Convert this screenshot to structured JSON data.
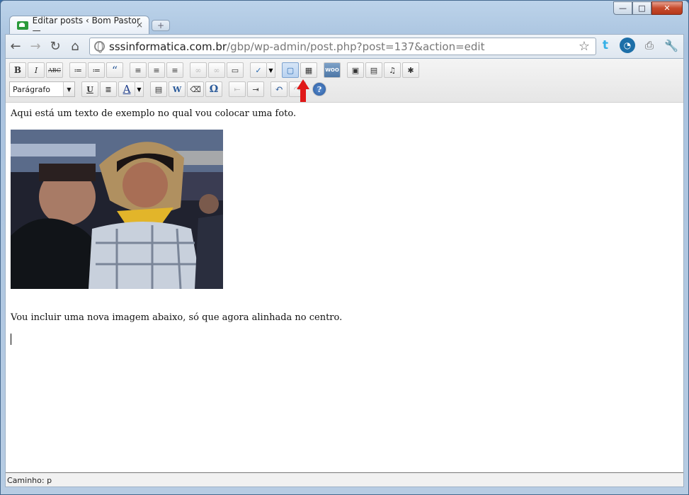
{
  "window": {
    "tab_title": "Editar posts ‹ Bom Pastor —",
    "tab_close": "×",
    "new_tab": "+",
    "controls": {
      "minimize": "—",
      "maximize": "□",
      "close": "✕"
    }
  },
  "navbar": {
    "back_icon": "←",
    "forward_icon": "→",
    "reload_icon": "↻",
    "home_icon": "⌂",
    "url_host": "sssinformatica.com.br",
    "url_path": "/gbp/wp-admin/post.php?post=137&action=edit",
    "bookmark_icon": "☆",
    "extensions": [
      {
        "name": "twitter-icon",
        "glyph": "t"
      },
      {
        "name": "clock-icon",
        "glyph": "◔"
      },
      {
        "name": "print-icon",
        "glyph": "⎙"
      },
      {
        "name": "wrench-icon",
        "glyph": "🔧"
      }
    ]
  },
  "toolbar": {
    "row1": [
      {
        "name": "bold",
        "glyph": "B"
      },
      {
        "name": "italic",
        "glyph": "I"
      },
      {
        "name": "strikethrough",
        "glyph": "ABC"
      },
      {
        "name": "bullet-list",
        "glyph": "≔"
      },
      {
        "name": "numbered-list",
        "glyph": "≔"
      },
      {
        "name": "blockquote",
        "glyph": "“"
      },
      {
        "name": "align-left",
        "glyph": "≡"
      },
      {
        "name": "align-center",
        "glyph": "≡"
      },
      {
        "name": "align-right",
        "glyph": "≡"
      },
      {
        "name": "link",
        "glyph": "∞"
      },
      {
        "name": "unlink",
        "glyph": "∞"
      },
      {
        "name": "more-tag",
        "glyph": "▭"
      },
      {
        "name": "spellcheck",
        "glyph": "✓"
      },
      {
        "name": "fullscreen",
        "glyph": "▢"
      },
      {
        "name": "kitchen-sink",
        "glyph": "▦"
      },
      {
        "name": "woo-shortcodes",
        "glyph": "WOO"
      },
      {
        "name": "add-image",
        "glyph": "▣"
      },
      {
        "name": "add-gallery",
        "glyph": "▤"
      },
      {
        "name": "add-audio",
        "glyph": "♫"
      },
      {
        "name": "add-media",
        "glyph": "✱"
      }
    ],
    "row2": {
      "format_select": "Parágrafo",
      "buttons": [
        {
          "name": "underline",
          "glyph": "U"
        },
        {
          "name": "justify",
          "glyph": "≣"
        },
        {
          "name": "text-color",
          "glyph": "A"
        },
        {
          "name": "paste-text",
          "glyph": "▤"
        },
        {
          "name": "paste-word",
          "glyph": "W"
        },
        {
          "name": "remove-format",
          "glyph": "⌫"
        },
        {
          "name": "special-char",
          "glyph": "Ω"
        },
        {
          "name": "outdent",
          "glyph": "⇤"
        },
        {
          "name": "indent",
          "glyph": "⇥"
        },
        {
          "name": "undo",
          "glyph": "↶"
        },
        {
          "name": "redo",
          "glyph": "↷"
        },
        {
          "name": "help",
          "glyph": "?"
        }
      ]
    }
  },
  "content": {
    "paragraph1": "Aqui está um texto de exemplo no qual vou colocar uma foto.",
    "paragraph2": "Vou incluir uma nova imagem abaixo, só que agora alinhada no centro."
  },
  "status": {
    "path": "Caminho: p"
  }
}
